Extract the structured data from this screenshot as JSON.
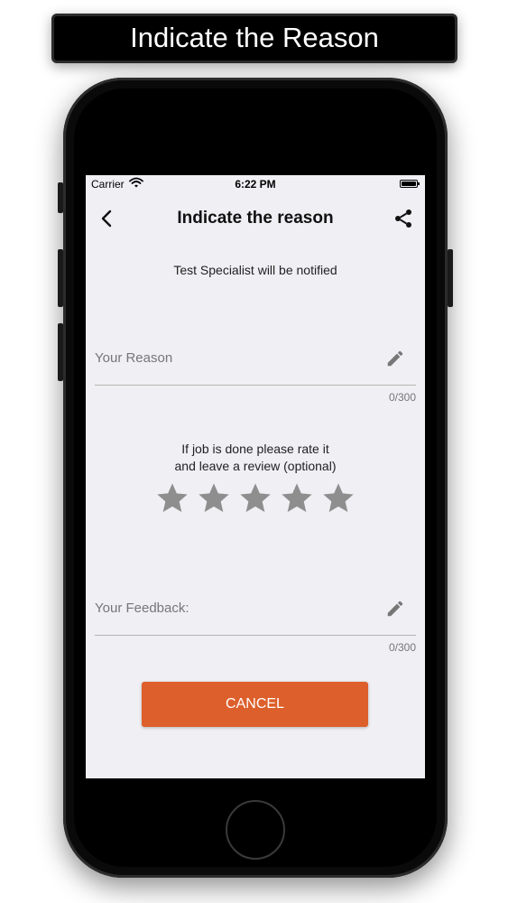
{
  "banner": {
    "title": "Indicate the Reason"
  },
  "status_bar": {
    "carrier": "Carrier",
    "time": "6:22 PM"
  },
  "nav": {
    "title": "Indicate the reason",
    "back_icon": "chevron-left-icon",
    "share_icon": "share-icon"
  },
  "notice": "Test Specialist will be notified",
  "reason_field": {
    "placeholder": "Your Reason",
    "value": "",
    "counter": "0/300",
    "icon": "pencil-icon"
  },
  "rating": {
    "prompt_line1": "If job is done please rate it",
    "prompt_line2": "and leave a review (optional)",
    "stars_total": 5,
    "stars_selected": 0,
    "star_color": "#8e8e8e"
  },
  "feedback_field": {
    "placeholder": "Your Feedback:",
    "value": "",
    "counter": "0/300",
    "icon": "pencil-icon"
  },
  "actions": {
    "cancel_label": "CANCEL"
  },
  "colors": {
    "accent": "#dd5f2b",
    "screen_bg": "#efeff4"
  }
}
